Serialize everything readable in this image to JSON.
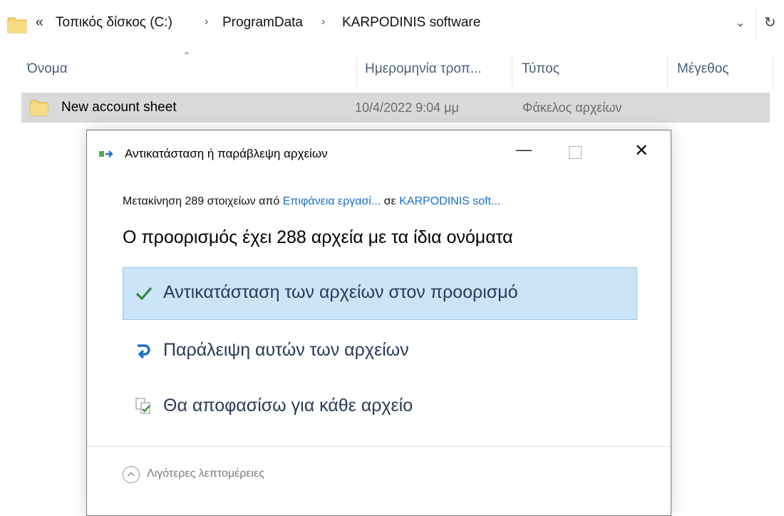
{
  "address_bar": {
    "overflow_chevron": "«",
    "crumbs": [
      "Τοπικός δίσκος (C:)",
      "ProgramData",
      "KARPODINIS software"
    ],
    "separator": "›",
    "dropdown_icon": "chevron-down-icon",
    "refresh_icon": "refresh-icon"
  },
  "columns": {
    "name": "Όνομα",
    "date": "Ημερομηνία τροπ...",
    "type": "Τύπος",
    "size": "Μέγεθος"
  },
  "files": [
    {
      "name": "New account sheet",
      "date": "10/4/2022 9:04 μμ",
      "type": "Φάκελος αρχείων"
    }
  ],
  "dialog": {
    "title": "Αντικατάσταση ή παράβλεψη αρχείων",
    "move_prefix": "Μετακίνηση 289 στοιχείων από ",
    "move_source": "Επιφάνεια εργασί...",
    "move_mid": " σε ",
    "move_dest": "KARPODINIS soft...",
    "heading": "Ο προορισμός έχει 288 αρχεία με τα ίδια ονόματα",
    "options": [
      {
        "label": "Αντικατάσταση των αρχείων στον προορισμό",
        "icon": "checkmark-icon",
        "selected": true
      },
      {
        "label": "Παράλειψη αυτών των αρχείων",
        "icon": "skip-arrow-icon",
        "selected": false
      },
      {
        "label": "Θα αποφασίσω για κάθε αρχείο",
        "icon": "compare-files-icon",
        "selected": false
      }
    ],
    "details_label": "Λιγότερες λεπτομέρειες"
  },
  "colors": {
    "selected_option_bg": "#cce4f7",
    "link": "#1a6fc9",
    "check_green": "#2e8b3a",
    "skip_blue": "#1e6fc9",
    "folder_yellow": "#f6d472"
  }
}
